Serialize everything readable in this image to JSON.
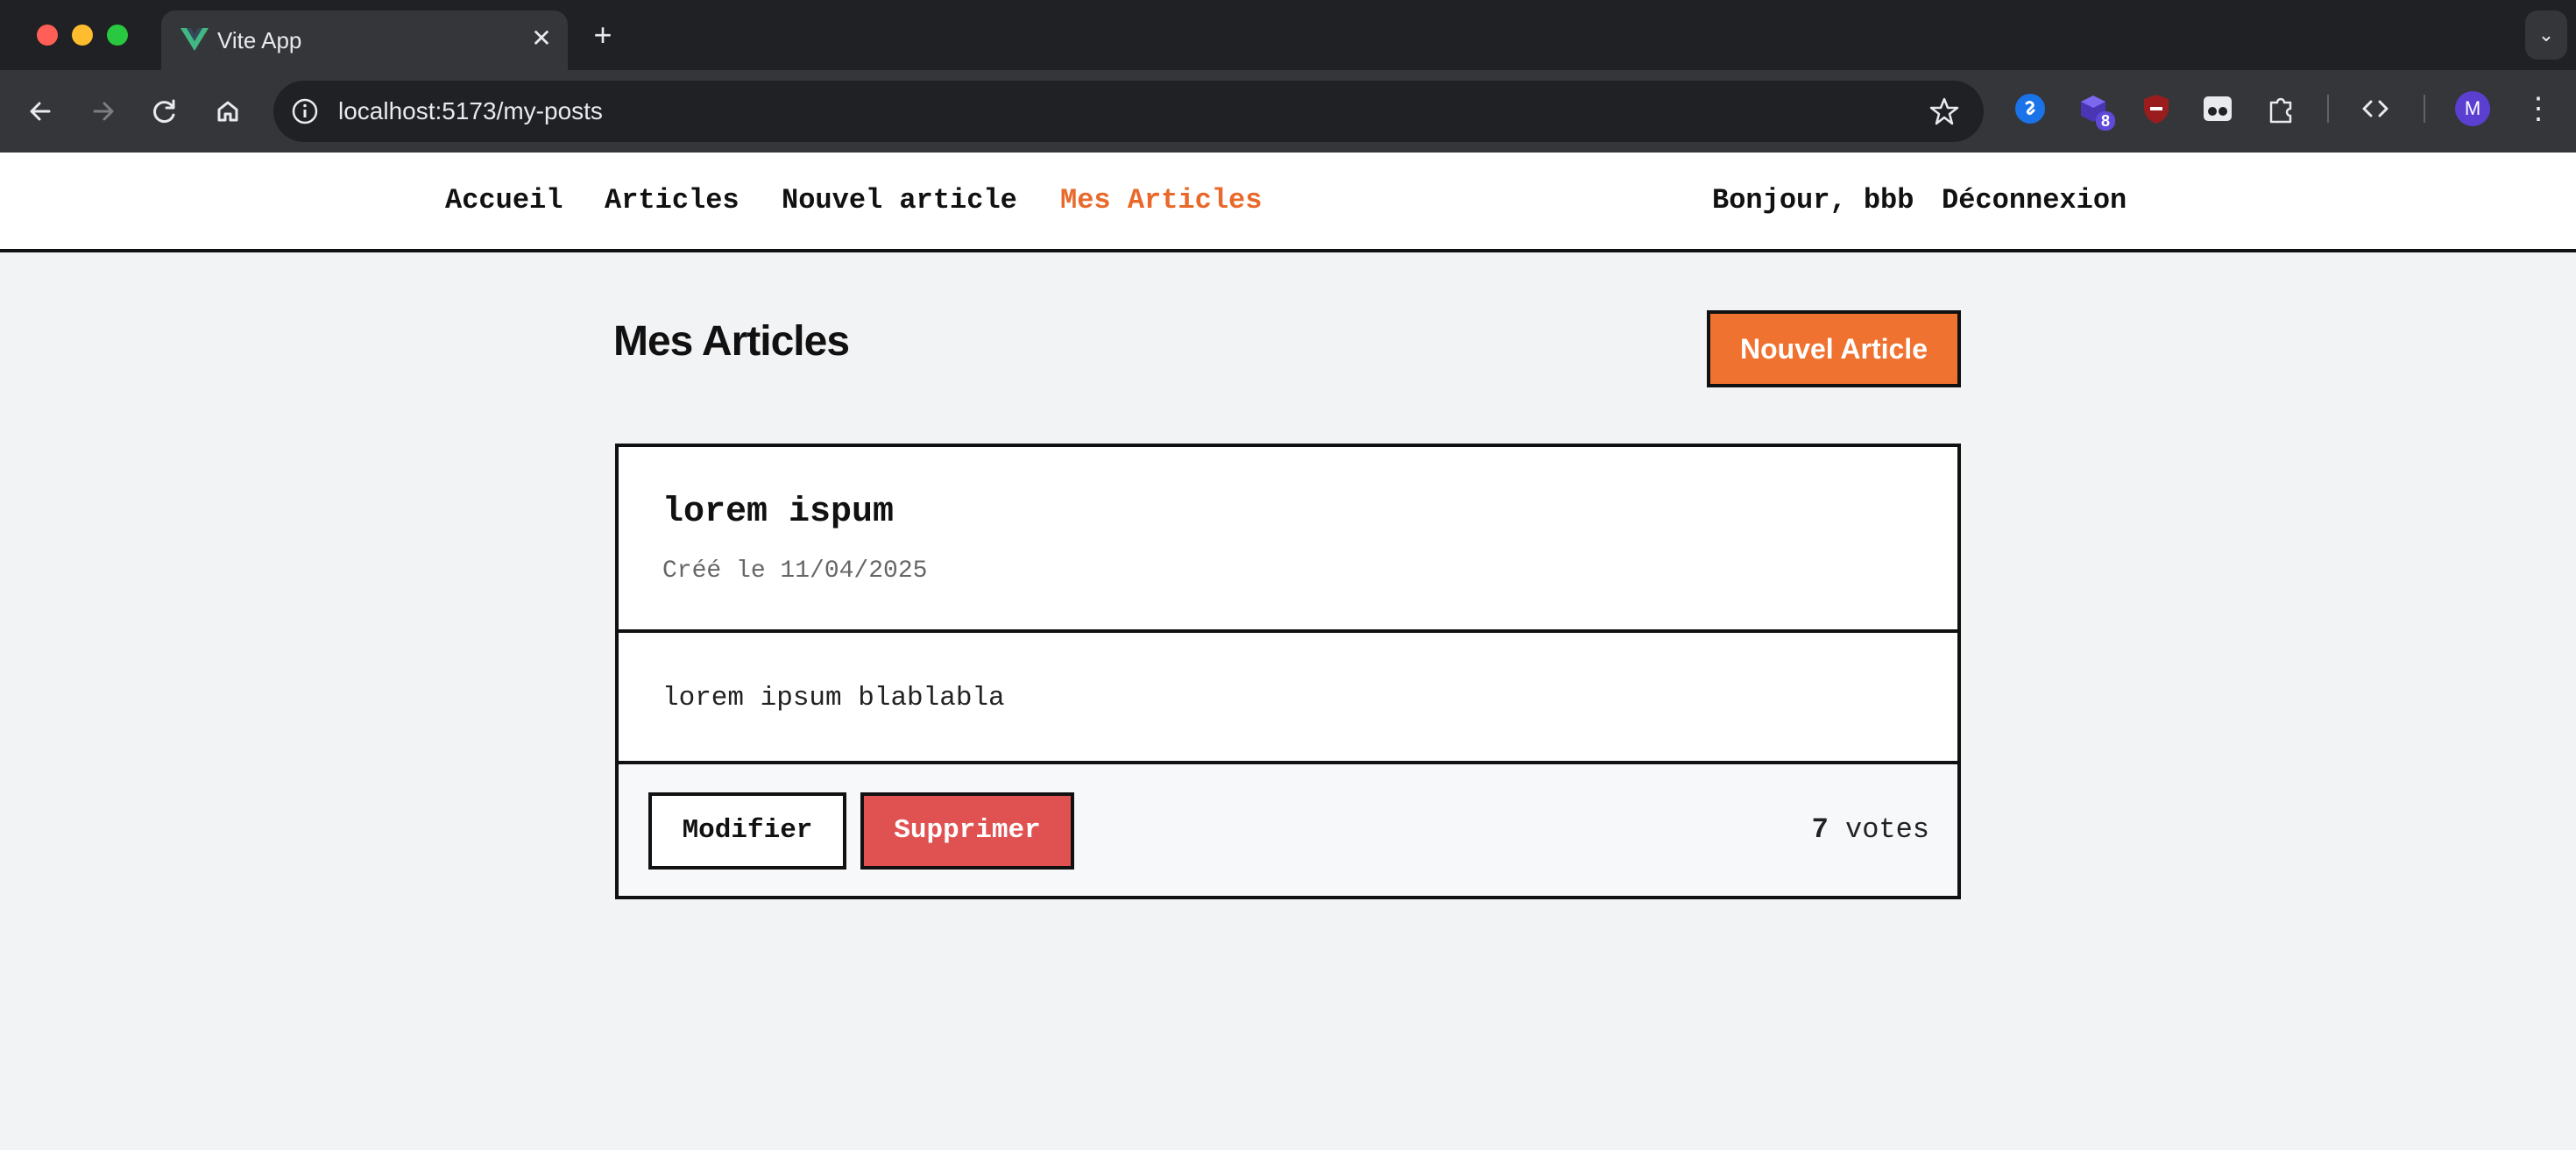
{
  "browser": {
    "tab_title": "Vite App",
    "tab_close": "✕",
    "new_tab": "+",
    "url": "localhost:5173/my-posts",
    "extension_badge": "8",
    "profile_initial": "M",
    "menu": "⋮",
    "tab_search": "⌄"
  },
  "nav": {
    "links": [
      "Accueil",
      "Articles",
      "Nouvel article",
      "Mes Articles"
    ],
    "active": "Mes Articles",
    "greeting": "Bonjour, bbb",
    "logout": "Déconnexion",
    "accent_color": "#e8692a"
  },
  "page": {
    "title": "Mes Articles",
    "new_article_button": "Nouvel Article"
  },
  "posts": [
    {
      "title": "lorem ispum",
      "date": "Créé le 11/04/2025",
      "content": "lorem ipsum blablabla",
      "edit_label": "Modifier",
      "delete_label": "Supprimer",
      "vote_count": "7",
      "vote_label": "votes"
    }
  ]
}
